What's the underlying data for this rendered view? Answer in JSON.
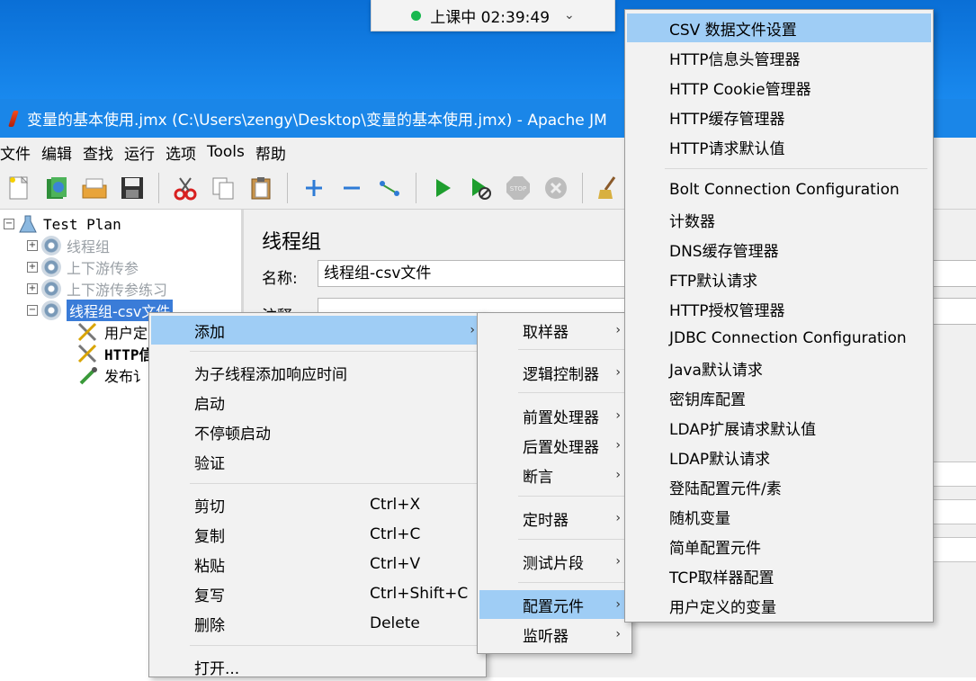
{
  "status_pill": {
    "text": "上课中 02:39:49"
  },
  "window": {
    "title": "变量的基本使用.jmx (C:\\Users\\zengy\\Desktop\\变量的基本使用.jmx) - Apache JM"
  },
  "menubar": [
    "文件",
    "编辑",
    "查找",
    "运行",
    "选项",
    "Tools",
    "帮助"
  ],
  "toolbar": [
    "new-file",
    "templates",
    "open",
    "save",
    "cut",
    "copy",
    "paste",
    "expand-all",
    "collapse-all",
    "toggle",
    "start",
    "start-no-pause",
    "stop",
    "shutdown",
    "clear"
  ],
  "tree": {
    "root": "Test Plan",
    "thread_groups": [
      "线程组",
      "上下游传参",
      "上下游传参练习",
      "线程组-csv文件"
    ],
    "children": [
      "用户定",
      "HTTP信",
      "发布讠"
    ]
  },
  "panel": {
    "title": "线程组",
    "name_label": "名称:",
    "name_value": "线程组-csv文件",
    "comment_label": "注释"
  },
  "context_menu": {
    "add": "添加",
    "items": [
      {
        "label": "为子线程添加响应时间"
      },
      {
        "label": "启动"
      },
      {
        "label": "不停顿启动"
      },
      {
        "label": "验证"
      }
    ],
    "edit_items": [
      {
        "label": "剪切",
        "shortcut": "Ctrl+X"
      },
      {
        "label": "复制",
        "shortcut": "Ctrl+C"
      },
      {
        "label": "粘贴",
        "shortcut": "Ctrl+V"
      },
      {
        "label": "复写",
        "shortcut": "Ctrl+Shift+C"
      },
      {
        "label": "删除",
        "shortcut": "Delete"
      }
    ],
    "open": "打开..."
  },
  "add_submenu": [
    "取样器",
    "逻辑控制器",
    "前置处理器",
    "后置处理器",
    "断言",
    "定时器",
    "测试片段",
    "配置元件",
    "监听器"
  ],
  "config_submenu": [
    "CSV 数据文件设置",
    "HTTP信息头管理器",
    "HTTP Cookie管理器",
    "HTTP缓存管理器",
    "HTTP请求默认值",
    "Bolt Connection Configuration",
    "计数器",
    "DNS缓存管理器",
    "FTP默认请求",
    "HTTP授权管理器",
    "JDBC Connection Configuration",
    "Java默认请求",
    "密钥库配置",
    "LDAP扩展请求默认值",
    "LDAP默认请求",
    "登陆配置元件/素",
    "随机变量",
    "简单配置元件",
    "TCP取样器配置",
    "用户定义的变量"
  ],
  "colors": {
    "highlight": "#9fcdf5",
    "title_bar": "#1a86e8",
    "selection": "#3a7cd8"
  }
}
